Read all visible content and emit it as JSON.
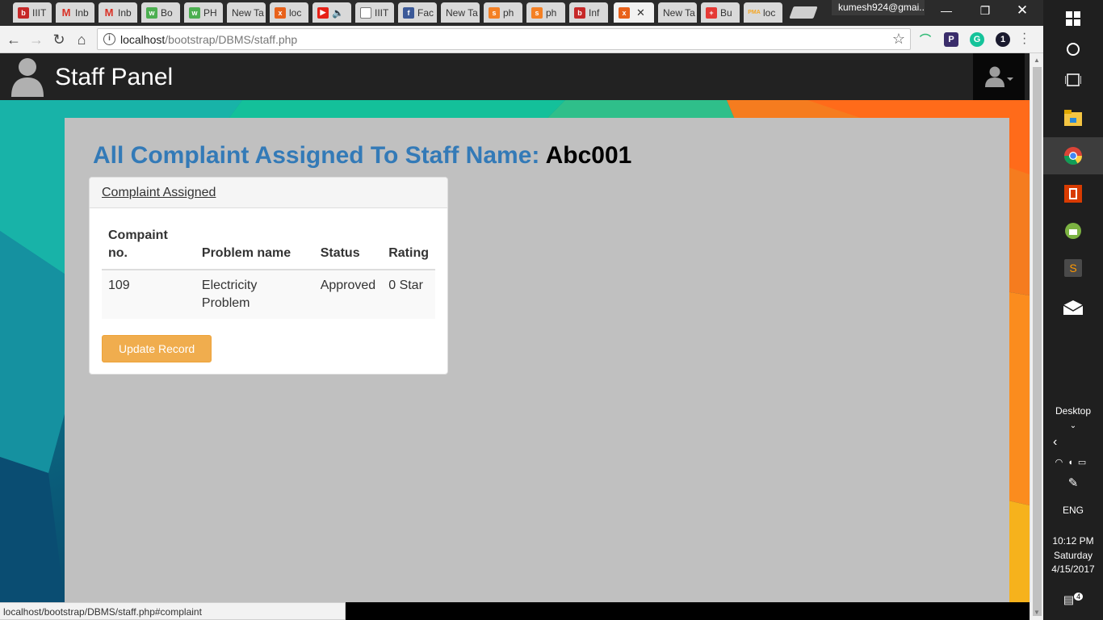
{
  "browser": {
    "tabs": [
      {
        "label": "IIIT",
        "icon": "bookmark-page-icon",
        "color": "#c62828"
      },
      {
        "label": "Inb",
        "icon": "gmail-icon",
        "color": "#d93025"
      },
      {
        "label": "Inb",
        "icon": "gmail-icon",
        "color": "#d93025"
      },
      {
        "label": "Bo",
        "icon": "w3-icon",
        "color": "#4caf50"
      },
      {
        "label": "PH",
        "icon": "w3-icon",
        "color": "#4caf50"
      },
      {
        "label": "New Ta",
        "icon": "",
        "color": ""
      },
      {
        "label": "loc",
        "icon": "xampp-icon",
        "color": "#e8611a"
      },
      {
        "label": "",
        "icon": "youtube-icon",
        "color": "#e62117"
      },
      {
        "label": "IIIT",
        "icon": "document-icon",
        "color": "#777"
      },
      {
        "label": "Fac",
        "icon": "facebook-icon",
        "color": "#3b5998"
      },
      {
        "label": "New Ta",
        "icon": "",
        "color": ""
      },
      {
        "label": "ph",
        "icon": "stackoverflow-icon",
        "color": "#f48024"
      },
      {
        "label": "ph",
        "icon": "stackoverflow-icon",
        "color": "#f48024"
      },
      {
        "label": "Inf",
        "icon": "bookmark-page-icon",
        "color": "#c62828"
      },
      {
        "label": "",
        "icon": "xampp-icon",
        "color": "#e8611a"
      },
      {
        "label": "New Ta",
        "icon": "",
        "color": ""
      },
      {
        "label": "Bu",
        "icon": "plus-cross-icon",
        "color": "#e53935"
      },
      {
        "label": "loc",
        "icon": "pma-icon",
        "color": "#f5a623"
      }
    ],
    "profile": "kumesh924@gmai...",
    "url_host": "localhost",
    "url_path": "/bootstrap/DBMS/staff.php",
    "status_url": "localhost/bootstrap/DBMS/staff.php#complaint"
  },
  "page": {
    "brand": "Staff Panel",
    "title_prefix": "All Complaint Assigned To Staff Name: ",
    "staff_name": "Abc001",
    "panel_heading": "Complaint Assigned",
    "table": {
      "headers": [
        "Compaint no.",
        "Problem name",
        "Status",
        "Rating"
      ],
      "rows": [
        [
          "109",
          "Electricity Problem",
          "Approved",
          "0 Star"
        ]
      ]
    },
    "update_button": "Update Record"
  },
  "taskbar": {
    "desktop_label": "Desktop",
    "language": "ENG",
    "time": "10:12 PM",
    "day": "Saturday",
    "date": "4/15/2017",
    "notification_count": "4"
  },
  "colors": {
    "link_blue": "#337ab7",
    "warning": "#f0ad4e",
    "navbar": "#222222"
  }
}
